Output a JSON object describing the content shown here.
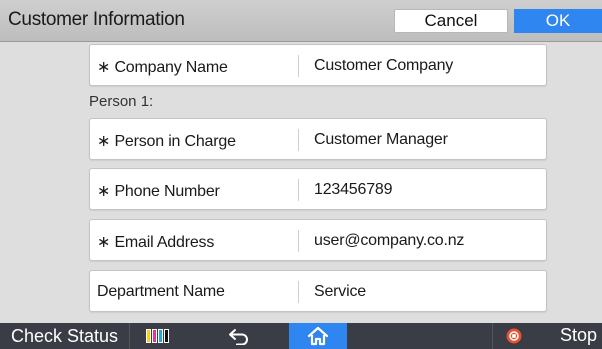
{
  "header": {
    "title": "Customer Information",
    "cancel_label": "Cancel",
    "ok_label": "OK"
  },
  "form": {
    "company": {
      "label": "∗ Company Name",
      "value": "Customer Company"
    },
    "section_label": "Person 1:",
    "fields": [
      {
        "label": "∗ Person in Charge",
        "value": "Customer Manager"
      },
      {
        "label": "∗ Phone Number",
        "value": "123456789"
      },
      {
        "label": "∗ Email Address",
        "value": "user@company.co.nz"
      },
      {
        "label": "Department Name",
        "value": "Service"
      }
    ]
  },
  "bottom_bar": {
    "check_status_label": "Check Status",
    "stop_label": "Stop",
    "toner_colors": [
      "#f2d21b",
      "#e0388d",
      "#29a8e0",
      "#111111"
    ],
    "accent_color": "#2f86f0",
    "stop_color": "#e8522f"
  }
}
